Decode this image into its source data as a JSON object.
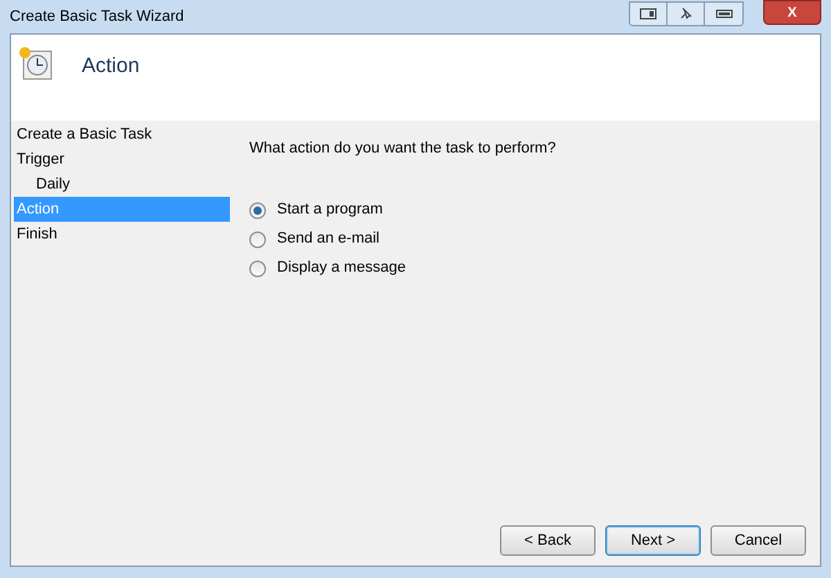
{
  "window": {
    "title": "Create Basic Task Wizard",
    "close_label": "X"
  },
  "header": {
    "title": "Action"
  },
  "steps": [
    {
      "label": "Create a Basic Task",
      "selected": false
    },
    {
      "label": "Trigger",
      "selected": false,
      "children": [
        {
          "label": "Daily",
          "selected": false
        }
      ]
    },
    {
      "label": "Action",
      "selected": true
    },
    {
      "label": "Finish",
      "selected": false
    }
  ],
  "question": "What action do you want the task to perform?",
  "options": [
    {
      "label": "Start a program",
      "selected": true
    },
    {
      "label": "Send an e-mail",
      "selected": false
    },
    {
      "label": "Display a message",
      "selected": false
    }
  ],
  "buttons": [
    {
      "label": "< Back",
      "kind": "normal"
    },
    {
      "label": "Next >",
      "kind": "default"
    },
    {
      "label": "Cancel",
      "kind": "normal"
    }
  ]
}
